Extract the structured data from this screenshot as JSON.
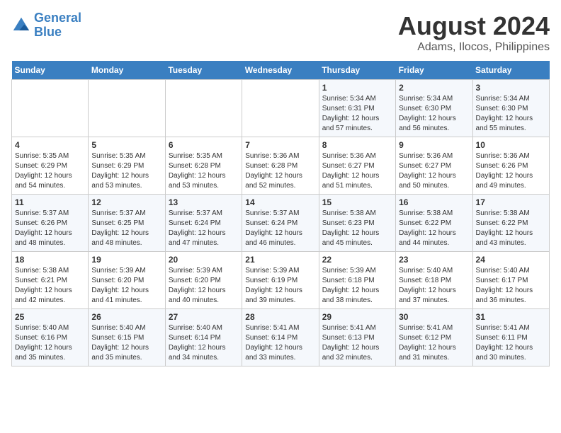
{
  "header": {
    "logo_line1": "General",
    "logo_line2": "Blue",
    "title": "August 2024",
    "subtitle": "Adams, Ilocos, Philippines"
  },
  "weekdays": [
    "Sunday",
    "Monday",
    "Tuesday",
    "Wednesday",
    "Thursday",
    "Friday",
    "Saturday"
  ],
  "weeks": [
    [
      {
        "day": "",
        "info": ""
      },
      {
        "day": "",
        "info": ""
      },
      {
        "day": "",
        "info": ""
      },
      {
        "day": "",
        "info": ""
      },
      {
        "day": "1",
        "info": "Sunrise: 5:34 AM\nSunset: 6:31 PM\nDaylight: 12 hours\nand 57 minutes."
      },
      {
        "day": "2",
        "info": "Sunrise: 5:34 AM\nSunset: 6:30 PM\nDaylight: 12 hours\nand 56 minutes."
      },
      {
        "day": "3",
        "info": "Sunrise: 5:34 AM\nSunset: 6:30 PM\nDaylight: 12 hours\nand 55 minutes."
      }
    ],
    [
      {
        "day": "4",
        "info": "Sunrise: 5:35 AM\nSunset: 6:29 PM\nDaylight: 12 hours\nand 54 minutes."
      },
      {
        "day": "5",
        "info": "Sunrise: 5:35 AM\nSunset: 6:29 PM\nDaylight: 12 hours\nand 53 minutes."
      },
      {
        "day": "6",
        "info": "Sunrise: 5:35 AM\nSunset: 6:28 PM\nDaylight: 12 hours\nand 53 minutes."
      },
      {
        "day": "7",
        "info": "Sunrise: 5:36 AM\nSunset: 6:28 PM\nDaylight: 12 hours\nand 52 minutes."
      },
      {
        "day": "8",
        "info": "Sunrise: 5:36 AM\nSunset: 6:27 PM\nDaylight: 12 hours\nand 51 minutes."
      },
      {
        "day": "9",
        "info": "Sunrise: 5:36 AM\nSunset: 6:27 PM\nDaylight: 12 hours\nand 50 minutes."
      },
      {
        "day": "10",
        "info": "Sunrise: 5:36 AM\nSunset: 6:26 PM\nDaylight: 12 hours\nand 49 minutes."
      }
    ],
    [
      {
        "day": "11",
        "info": "Sunrise: 5:37 AM\nSunset: 6:26 PM\nDaylight: 12 hours\nand 48 minutes."
      },
      {
        "day": "12",
        "info": "Sunrise: 5:37 AM\nSunset: 6:25 PM\nDaylight: 12 hours\nand 48 minutes."
      },
      {
        "day": "13",
        "info": "Sunrise: 5:37 AM\nSunset: 6:24 PM\nDaylight: 12 hours\nand 47 minutes."
      },
      {
        "day": "14",
        "info": "Sunrise: 5:37 AM\nSunset: 6:24 PM\nDaylight: 12 hours\nand 46 minutes."
      },
      {
        "day": "15",
        "info": "Sunrise: 5:38 AM\nSunset: 6:23 PM\nDaylight: 12 hours\nand 45 minutes."
      },
      {
        "day": "16",
        "info": "Sunrise: 5:38 AM\nSunset: 6:22 PM\nDaylight: 12 hours\nand 44 minutes."
      },
      {
        "day": "17",
        "info": "Sunrise: 5:38 AM\nSunset: 6:22 PM\nDaylight: 12 hours\nand 43 minutes."
      }
    ],
    [
      {
        "day": "18",
        "info": "Sunrise: 5:38 AM\nSunset: 6:21 PM\nDaylight: 12 hours\nand 42 minutes."
      },
      {
        "day": "19",
        "info": "Sunrise: 5:39 AM\nSunset: 6:20 PM\nDaylight: 12 hours\nand 41 minutes."
      },
      {
        "day": "20",
        "info": "Sunrise: 5:39 AM\nSunset: 6:20 PM\nDaylight: 12 hours\nand 40 minutes."
      },
      {
        "day": "21",
        "info": "Sunrise: 5:39 AM\nSunset: 6:19 PM\nDaylight: 12 hours\nand 39 minutes."
      },
      {
        "day": "22",
        "info": "Sunrise: 5:39 AM\nSunset: 6:18 PM\nDaylight: 12 hours\nand 38 minutes."
      },
      {
        "day": "23",
        "info": "Sunrise: 5:40 AM\nSunset: 6:18 PM\nDaylight: 12 hours\nand 37 minutes."
      },
      {
        "day": "24",
        "info": "Sunrise: 5:40 AM\nSunset: 6:17 PM\nDaylight: 12 hours\nand 36 minutes."
      }
    ],
    [
      {
        "day": "25",
        "info": "Sunrise: 5:40 AM\nSunset: 6:16 PM\nDaylight: 12 hours\nand 35 minutes."
      },
      {
        "day": "26",
        "info": "Sunrise: 5:40 AM\nSunset: 6:15 PM\nDaylight: 12 hours\nand 35 minutes."
      },
      {
        "day": "27",
        "info": "Sunrise: 5:40 AM\nSunset: 6:14 PM\nDaylight: 12 hours\nand 34 minutes."
      },
      {
        "day": "28",
        "info": "Sunrise: 5:41 AM\nSunset: 6:14 PM\nDaylight: 12 hours\nand 33 minutes."
      },
      {
        "day": "29",
        "info": "Sunrise: 5:41 AM\nSunset: 6:13 PM\nDaylight: 12 hours\nand 32 minutes."
      },
      {
        "day": "30",
        "info": "Sunrise: 5:41 AM\nSunset: 6:12 PM\nDaylight: 12 hours\nand 31 minutes."
      },
      {
        "day": "31",
        "info": "Sunrise: 5:41 AM\nSunset: 6:11 PM\nDaylight: 12 hours\nand 30 minutes."
      }
    ]
  ]
}
